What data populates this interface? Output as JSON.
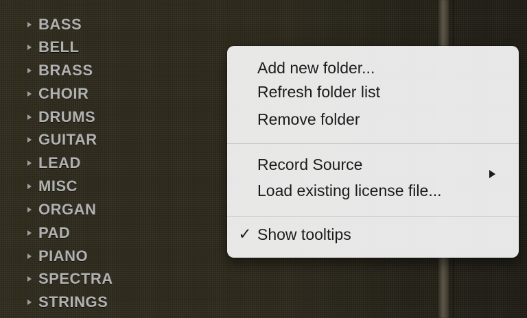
{
  "browser": {
    "items": [
      {
        "label": "BASS"
      },
      {
        "label": "BELL"
      },
      {
        "label": "BRASS"
      },
      {
        "label": "CHOIR"
      },
      {
        "label": "DRUMS"
      },
      {
        "label": "GUITAR"
      },
      {
        "label": "LEAD"
      },
      {
        "label": "MISC"
      },
      {
        "label": "ORGAN"
      },
      {
        "label": "PAD"
      },
      {
        "label": "PIANO"
      },
      {
        "label": "SPECTRA"
      },
      {
        "label": "STRINGS"
      }
    ]
  },
  "context_menu": {
    "items": [
      {
        "label": "Add new folder..."
      },
      {
        "label": "Refresh folder list"
      },
      {
        "label": "Remove folder"
      },
      {
        "label": "Record Source",
        "submenu": true
      },
      {
        "label": "Load existing license file..."
      },
      {
        "label": "Show tooltips",
        "checked": true
      }
    ],
    "checkmark": "✓"
  },
  "icons": {
    "disclosure": "triangle-right-icon",
    "submenu": "triangle-right-icon"
  },
  "colors": {
    "list_text": "#b1b1b1",
    "menu_background": "#ececec",
    "menu_text": "#1b1b1b"
  }
}
